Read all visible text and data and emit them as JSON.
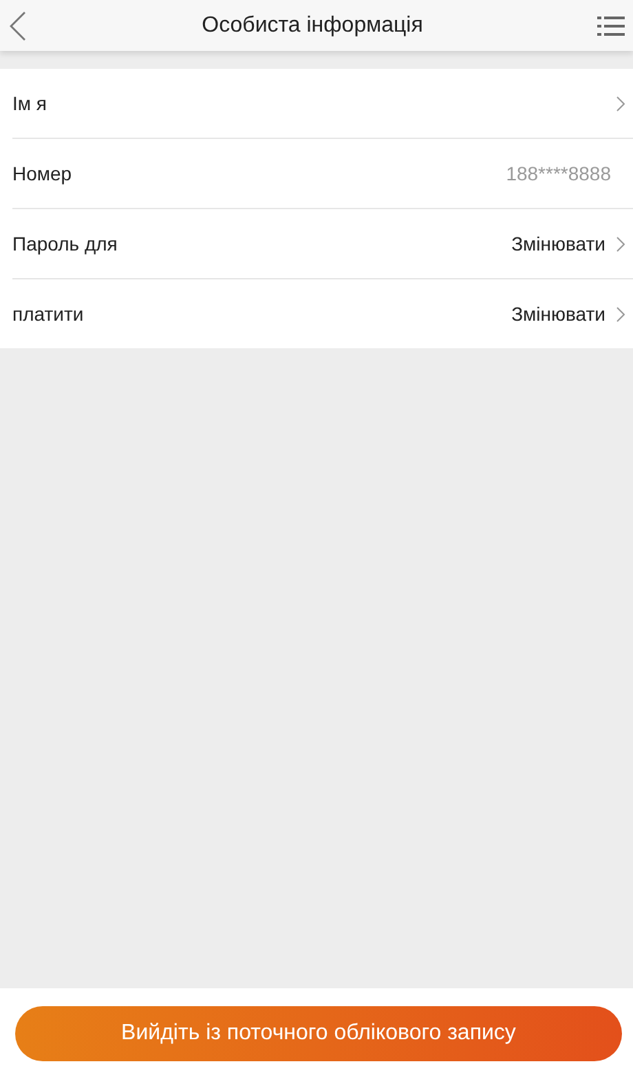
{
  "header": {
    "title": "Особиста інформація"
  },
  "rows": [
    {
      "kind": "link",
      "label": "Ім я"
    },
    {
      "kind": "info",
      "label": "Номер",
      "value": "188****8888"
    },
    {
      "kind": "link",
      "label": "Пароль для",
      "value": "Змінювати"
    },
    {
      "kind": "link",
      "label": "платити",
      "value": "Змінювати"
    }
  ],
  "logout_button": "Вийдіть із поточного облікового запису"
}
